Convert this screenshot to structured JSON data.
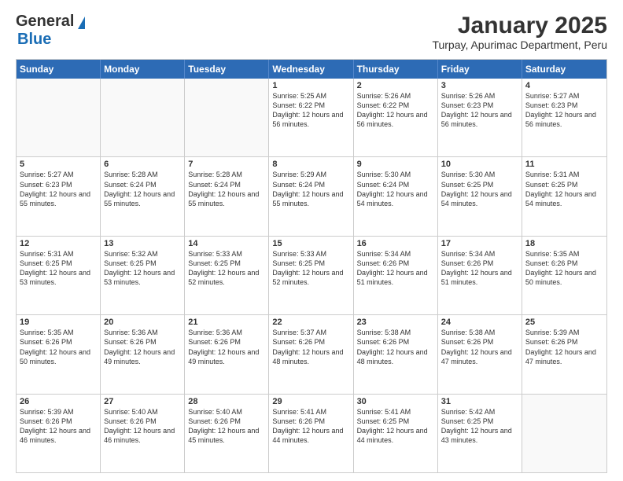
{
  "header": {
    "logo_general": "General",
    "logo_blue": "Blue",
    "title": "January 2025",
    "subtitle": "Turpay, Apurimac Department, Peru"
  },
  "weekdays": [
    "Sunday",
    "Monday",
    "Tuesday",
    "Wednesday",
    "Thursday",
    "Friday",
    "Saturday"
  ],
  "weeks": [
    [
      {
        "day": "",
        "sunrise": "",
        "sunset": "",
        "daylight": "",
        "empty": true
      },
      {
        "day": "",
        "sunrise": "",
        "sunset": "",
        "daylight": "",
        "empty": true
      },
      {
        "day": "",
        "sunrise": "",
        "sunset": "",
        "daylight": "",
        "empty": true
      },
      {
        "day": "1",
        "sunrise": "Sunrise: 5:25 AM",
        "sunset": "Sunset: 6:22 PM",
        "daylight": "Daylight: 12 hours and 56 minutes.",
        "empty": false
      },
      {
        "day": "2",
        "sunrise": "Sunrise: 5:26 AM",
        "sunset": "Sunset: 6:22 PM",
        "daylight": "Daylight: 12 hours and 56 minutes.",
        "empty": false
      },
      {
        "day": "3",
        "sunrise": "Sunrise: 5:26 AM",
        "sunset": "Sunset: 6:23 PM",
        "daylight": "Daylight: 12 hours and 56 minutes.",
        "empty": false
      },
      {
        "day": "4",
        "sunrise": "Sunrise: 5:27 AM",
        "sunset": "Sunset: 6:23 PM",
        "daylight": "Daylight: 12 hours and 56 minutes.",
        "empty": false
      }
    ],
    [
      {
        "day": "5",
        "sunrise": "Sunrise: 5:27 AM",
        "sunset": "Sunset: 6:23 PM",
        "daylight": "Daylight: 12 hours and 55 minutes.",
        "empty": false
      },
      {
        "day": "6",
        "sunrise": "Sunrise: 5:28 AM",
        "sunset": "Sunset: 6:24 PM",
        "daylight": "Daylight: 12 hours and 55 minutes.",
        "empty": false
      },
      {
        "day": "7",
        "sunrise": "Sunrise: 5:28 AM",
        "sunset": "Sunset: 6:24 PM",
        "daylight": "Daylight: 12 hours and 55 minutes.",
        "empty": false
      },
      {
        "day": "8",
        "sunrise": "Sunrise: 5:29 AM",
        "sunset": "Sunset: 6:24 PM",
        "daylight": "Daylight: 12 hours and 55 minutes.",
        "empty": false
      },
      {
        "day": "9",
        "sunrise": "Sunrise: 5:30 AM",
        "sunset": "Sunset: 6:24 PM",
        "daylight": "Daylight: 12 hours and 54 minutes.",
        "empty": false
      },
      {
        "day": "10",
        "sunrise": "Sunrise: 5:30 AM",
        "sunset": "Sunset: 6:25 PM",
        "daylight": "Daylight: 12 hours and 54 minutes.",
        "empty": false
      },
      {
        "day": "11",
        "sunrise": "Sunrise: 5:31 AM",
        "sunset": "Sunset: 6:25 PM",
        "daylight": "Daylight: 12 hours and 54 minutes.",
        "empty": false
      }
    ],
    [
      {
        "day": "12",
        "sunrise": "Sunrise: 5:31 AM",
        "sunset": "Sunset: 6:25 PM",
        "daylight": "Daylight: 12 hours and 53 minutes.",
        "empty": false
      },
      {
        "day": "13",
        "sunrise": "Sunrise: 5:32 AM",
        "sunset": "Sunset: 6:25 PM",
        "daylight": "Daylight: 12 hours and 53 minutes.",
        "empty": false
      },
      {
        "day": "14",
        "sunrise": "Sunrise: 5:33 AM",
        "sunset": "Sunset: 6:25 PM",
        "daylight": "Daylight: 12 hours and 52 minutes.",
        "empty": false
      },
      {
        "day": "15",
        "sunrise": "Sunrise: 5:33 AM",
        "sunset": "Sunset: 6:25 PM",
        "daylight": "Daylight: 12 hours and 52 minutes.",
        "empty": false
      },
      {
        "day": "16",
        "sunrise": "Sunrise: 5:34 AM",
        "sunset": "Sunset: 6:26 PM",
        "daylight": "Daylight: 12 hours and 51 minutes.",
        "empty": false
      },
      {
        "day": "17",
        "sunrise": "Sunrise: 5:34 AM",
        "sunset": "Sunset: 6:26 PM",
        "daylight": "Daylight: 12 hours and 51 minutes.",
        "empty": false
      },
      {
        "day": "18",
        "sunrise": "Sunrise: 5:35 AM",
        "sunset": "Sunset: 6:26 PM",
        "daylight": "Daylight: 12 hours and 50 minutes.",
        "empty": false
      }
    ],
    [
      {
        "day": "19",
        "sunrise": "Sunrise: 5:35 AM",
        "sunset": "Sunset: 6:26 PM",
        "daylight": "Daylight: 12 hours and 50 minutes.",
        "empty": false
      },
      {
        "day": "20",
        "sunrise": "Sunrise: 5:36 AM",
        "sunset": "Sunset: 6:26 PM",
        "daylight": "Daylight: 12 hours and 49 minutes.",
        "empty": false
      },
      {
        "day": "21",
        "sunrise": "Sunrise: 5:36 AM",
        "sunset": "Sunset: 6:26 PM",
        "daylight": "Daylight: 12 hours and 49 minutes.",
        "empty": false
      },
      {
        "day": "22",
        "sunrise": "Sunrise: 5:37 AM",
        "sunset": "Sunset: 6:26 PM",
        "daylight": "Daylight: 12 hours and 48 minutes.",
        "empty": false
      },
      {
        "day": "23",
        "sunrise": "Sunrise: 5:38 AM",
        "sunset": "Sunset: 6:26 PM",
        "daylight": "Daylight: 12 hours and 48 minutes.",
        "empty": false
      },
      {
        "day": "24",
        "sunrise": "Sunrise: 5:38 AM",
        "sunset": "Sunset: 6:26 PM",
        "daylight": "Daylight: 12 hours and 47 minutes.",
        "empty": false
      },
      {
        "day": "25",
        "sunrise": "Sunrise: 5:39 AM",
        "sunset": "Sunset: 6:26 PM",
        "daylight": "Daylight: 12 hours and 47 minutes.",
        "empty": false
      }
    ],
    [
      {
        "day": "26",
        "sunrise": "Sunrise: 5:39 AM",
        "sunset": "Sunset: 6:26 PM",
        "daylight": "Daylight: 12 hours and 46 minutes.",
        "empty": false
      },
      {
        "day": "27",
        "sunrise": "Sunrise: 5:40 AM",
        "sunset": "Sunset: 6:26 PM",
        "daylight": "Daylight: 12 hours and 46 minutes.",
        "empty": false
      },
      {
        "day": "28",
        "sunrise": "Sunrise: 5:40 AM",
        "sunset": "Sunset: 6:26 PM",
        "daylight": "Daylight: 12 hours and 45 minutes.",
        "empty": false
      },
      {
        "day": "29",
        "sunrise": "Sunrise: 5:41 AM",
        "sunset": "Sunset: 6:26 PM",
        "daylight": "Daylight: 12 hours and 44 minutes.",
        "empty": false
      },
      {
        "day": "30",
        "sunrise": "Sunrise: 5:41 AM",
        "sunset": "Sunset: 6:25 PM",
        "daylight": "Daylight: 12 hours and 44 minutes.",
        "empty": false
      },
      {
        "day": "31",
        "sunrise": "Sunrise: 5:42 AM",
        "sunset": "Sunset: 6:25 PM",
        "daylight": "Daylight: 12 hours and 43 minutes.",
        "empty": false
      },
      {
        "day": "",
        "sunrise": "",
        "sunset": "",
        "daylight": "",
        "empty": true
      }
    ]
  ]
}
